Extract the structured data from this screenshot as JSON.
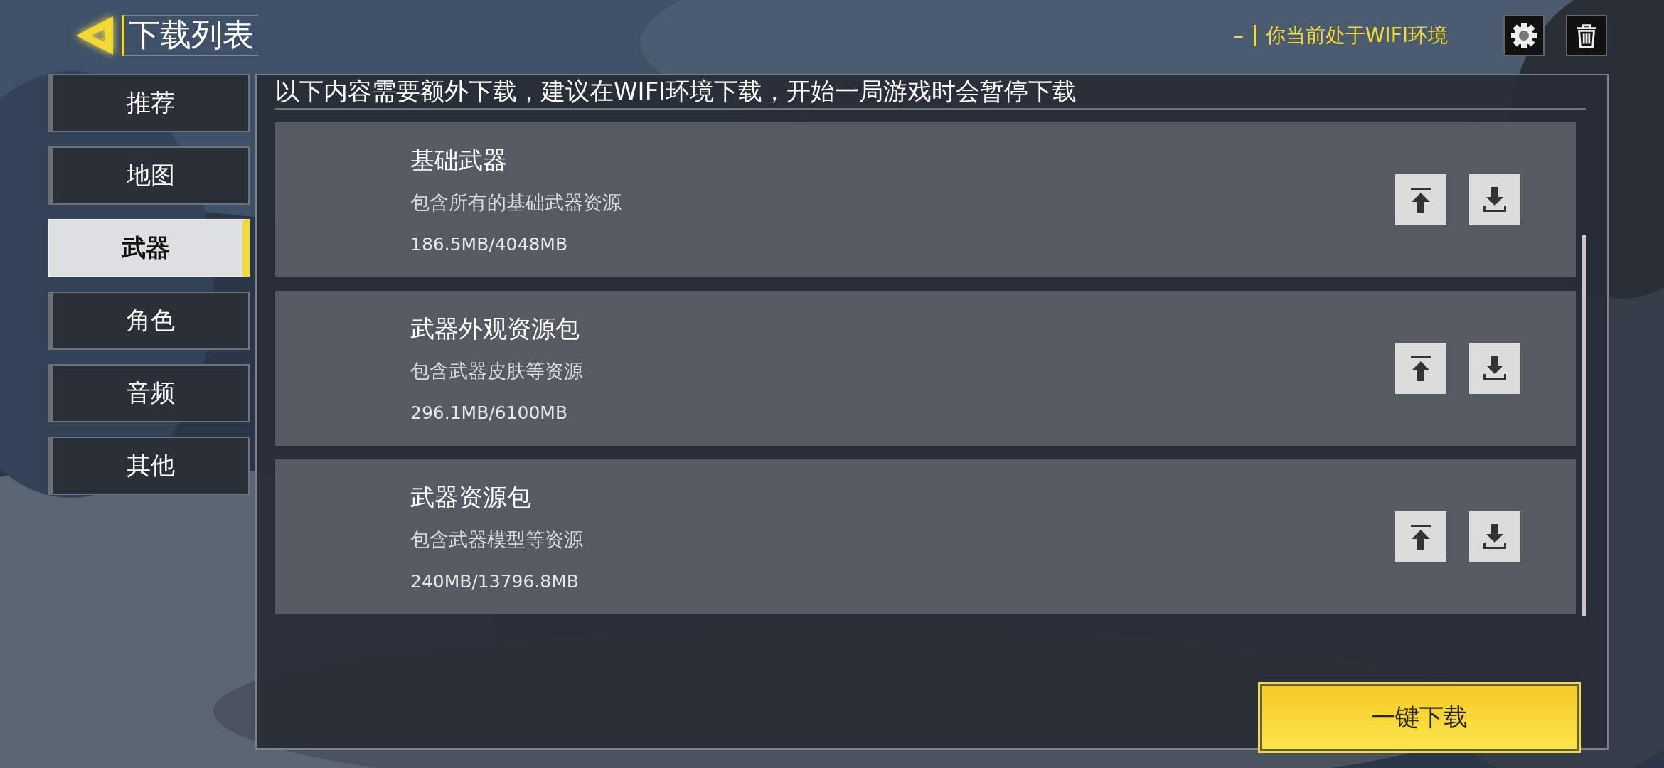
{
  "header": {
    "title": "下载列表",
    "status_mark": "–",
    "status": "你当前处于WIFI环境"
  },
  "tabs": [
    {
      "label": "推荐",
      "selected": false
    },
    {
      "label": "地图",
      "selected": false
    },
    {
      "label": "武器",
      "selected": true
    },
    {
      "label": "角色",
      "selected": false
    },
    {
      "label": "音频",
      "selected": false
    },
    {
      "label": "其他",
      "selected": false
    }
  ],
  "notice": "以下内容需要额外下载，建议在WIFI环境下载，开始一局游戏时会暂停下载",
  "packages": [
    {
      "title": "基础武器",
      "description": "包含所有的基础武器资源",
      "size": "186.5MB/4048MB"
    },
    {
      "title": "武器外观资源包",
      "description": "包含武器皮肤等资源",
      "size": "296.1MB/6100MB"
    },
    {
      "title": "武器资源包",
      "description": "包含武器模型等资源",
      "size": "240MB/13796.8MB"
    }
  ],
  "download_all": "一键下载"
}
